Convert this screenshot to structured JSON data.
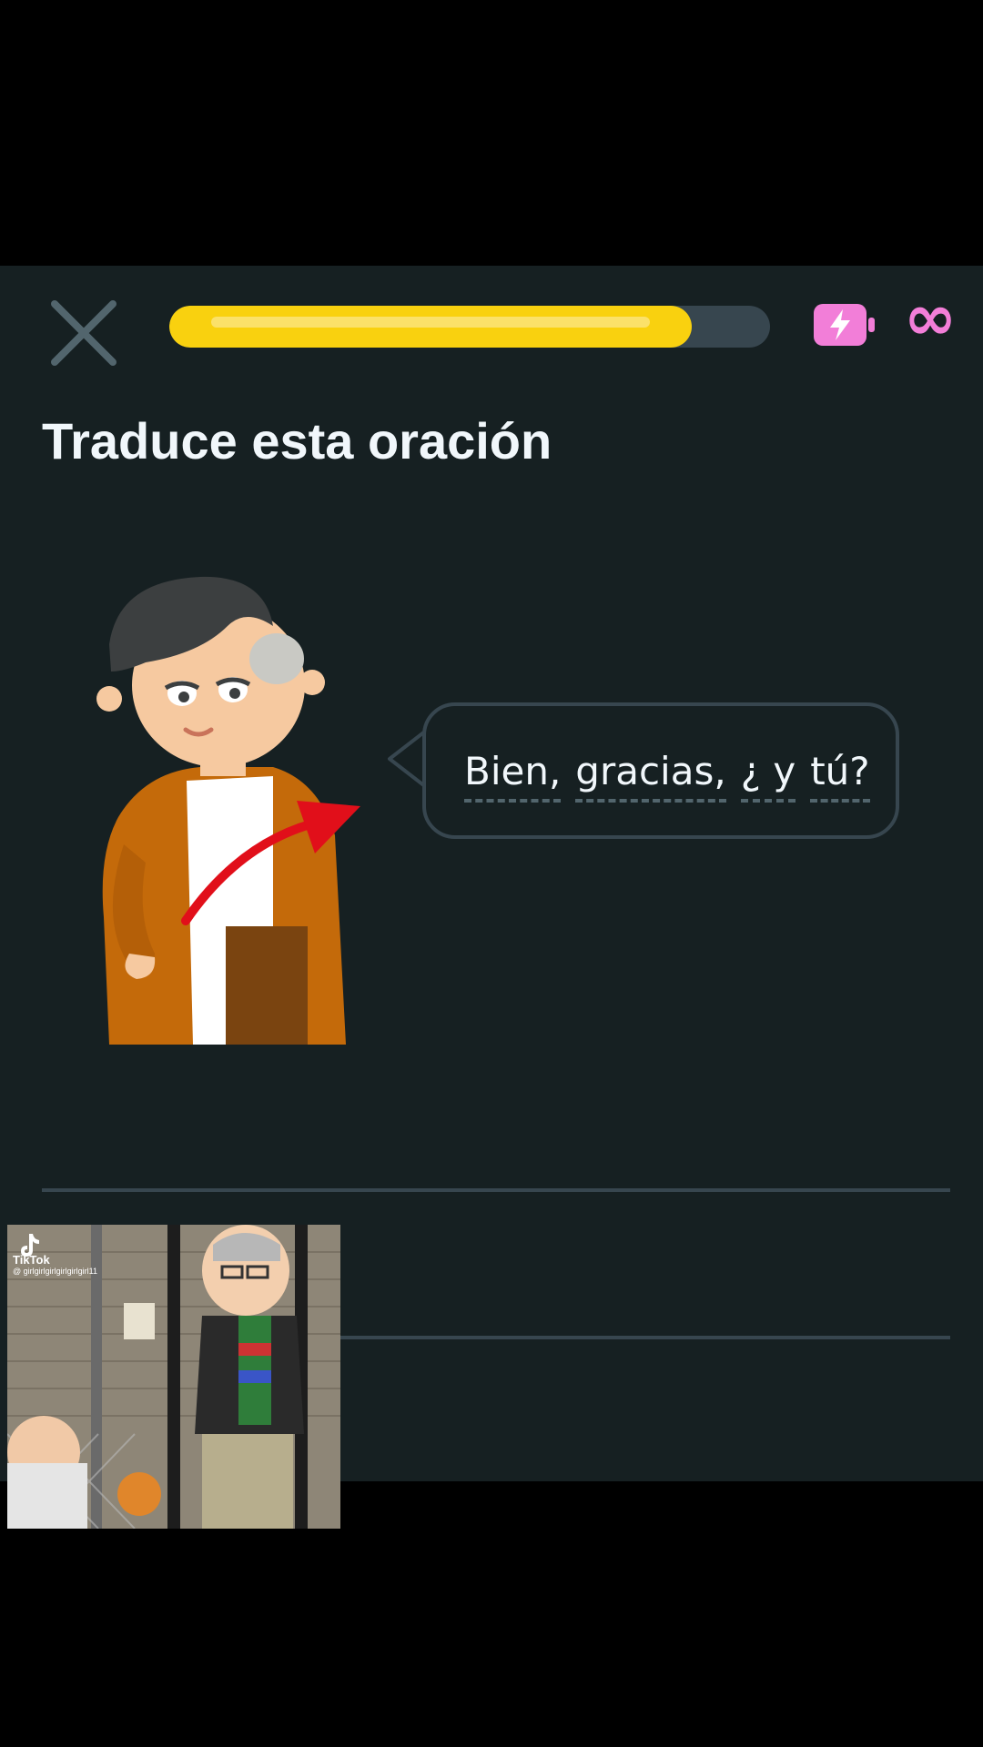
{
  "header": {
    "close_icon": "close-x-icon",
    "progress": 0.87,
    "energy_icon": "battery-bolt-icon",
    "energy_value": "∞",
    "colors": {
      "progress_fill": "#f9d10f",
      "progress_track": "#37464f",
      "energy": "#f27ed8"
    }
  },
  "main": {
    "title": "Traduce esta oración",
    "sentence_words": [
      "Bien,",
      "gracias,",
      "¿ y",
      "tú?"
    ]
  },
  "overlay": {
    "brand": "TikTok",
    "handle": "@ girlgirlgirlgirlgirlgirl11"
  },
  "colors": {
    "background": "#162022",
    "text": "#f1f7fb"
  }
}
